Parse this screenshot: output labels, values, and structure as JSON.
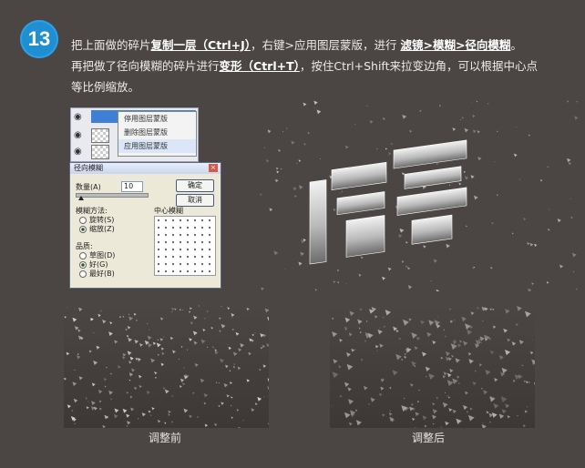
{
  "step": {
    "number": "13"
  },
  "instructions": {
    "line1": {
      "a": "把上面做的碎片",
      "b": "复制一层（Ctrl+J）",
      "c": "，右键>应用图层蒙版，进行",
      "d": "滤镜>模糊>径向模糊",
      "e": "。"
    },
    "line2": {
      "a": "再把做了径向模糊的碎片进行",
      "b": "变形（Ctrl+T）",
      "c": "，按住Ctrl+Shift来拉变边角，可以根据中心点"
    },
    "line3": "等比例缩放。"
  },
  "layers_panel": {
    "menu_items": [
      "停用图层蒙版",
      "删除图层蒙版",
      "应用图层蒙版"
    ]
  },
  "radial_blur_dialog": {
    "title": "径向模糊",
    "amount_label": "数量(A)",
    "amount_value": "10",
    "ok_label": "确定",
    "cancel_label": "取消",
    "method_label": "模糊方法:",
    "method_spin": "旋转(S)",
    "method_zoom": "缩放(Z)",
    "center_label": "中心模糊",
    "quality_label": "品质:",
    "quality_draft": "草图(D)",
    "quality_good": "好(G)",
    "quality_best": "最好(B)"
  },
  "captions": {
    "before": "调整前",
    "after": "调整后"
  },
  "colors": {
    "background": "#4b4644",
    "step_badge": "#1f8fd2"
  }
}
